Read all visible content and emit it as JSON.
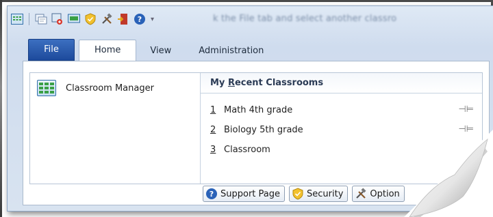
{
  "toolbar_hint": "k the File tab and select another classro",
  "tabs": [
    {
      "label": "File"
    },
    {
      "label": "Home"
    },
    {
      "label": "View"
    },
    {
      "label": "Administration"
    }
  ],
  "left": {
    "item_label": "Classroom Manager",
    "icon": "grid-icon"
  },
  "recent": {
    "heading_pre": "My ",
    "heading_underlined": "R",
    "heading_post": "ecent Classrooms",
    "items": [
      {
        "num": "1",
        "name": "Math 4th grade"
      },
      {
        "num": "2",
        "name": "Biology 5th grade"
      },
      {
        "num": "3",
        "name": "Classroom"
      }
    ]
  },
  "buttons": {
    "support": "Support Page",
    "security": "Security",
    "options": "Option"
  },
  "colors": {
    "file_tab": "#1d4a9c",
    "accent": "#3aa046"
  }
}
